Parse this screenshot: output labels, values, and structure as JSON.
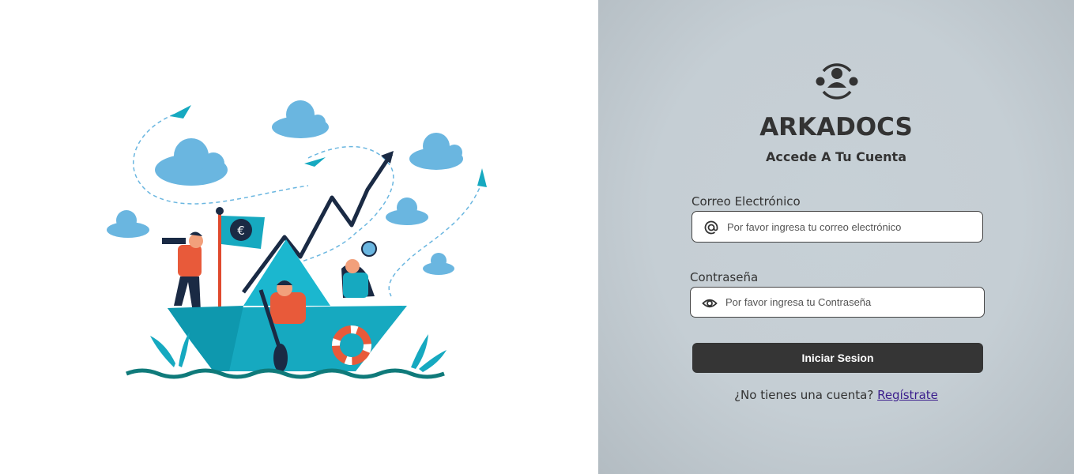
{
  "brand": {
    "name": "ARKADOCS",
    "subtitle": "Accede A Tu Cuenta",
    "logo_icon": "users-circle-icon"
  },
  "form": {
    "email": {
      "label": "Correo Electrónico",
      "placeholder": "Por favor ingresa tu correo electrónico",
      "value": "",
      "icon": "at-sign-icon"
    },
    "password": {
      "label": "Contraseña",
      "placeholder": "Por favor ingresa tu Contraseña",
      "value": "",
      "icon": "eye-icon"
    },
    "submit_label": "Iniciar Sesion"
  },
  "signup": {
    "prompt": "¿No tienes una cuenta?",
    "link": "Regístrate"
  },
  "colors": {
    "panel_bg": "#c5ced4",
    "button_bg": "#353535",
    "accent_teal": "#16a9c0",
    "cloud": "#6ab6e0",
    "navy": "#1a2a44",
    "link": "#3a1d8c"
  }
}
